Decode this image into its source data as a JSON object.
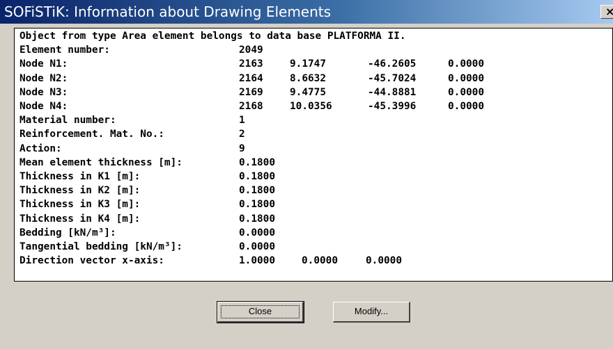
{
  "window": {
    "title": "SOFiSTiK: Information about Drawing Elements",
    "close_glyph": "×"
  },
  "info": {
    "lines": [
      [
        "Object from type Area element belongs to data base PLATFORMA II."
      ],
      [
        "Element number:",
        "2049"
      ],
      [
        "Node N1:",
        "2163",
        "9.1747",
        "-46.2605",
        "0.0000"
      ],
      [
        "Node N2:",
        "2164",
        "8.6632",
        "-45.7024",
        "0.0000"
      ],
      [
        "Node N3:",
        "2169",
        "9.4775",
        "-44.8881",
        "0.0000"
      ],
      [
        "Node N4:",
        "2168",
        "10.0356",
        "-45.3996",
        "0.0000"
      ],
      [
        "Material number:",
        "1"
      ],
      [
        "Reinforcement. Mat. No.:",
        "2"
      ],
      [
        "Action:",
        "9"
      ],
      [
        "Mean element thickness [m]:",
        "0.1800"
      ],
      [
        "Thickness in K1 [m]:",
        "0.1800"
      ],
      [
        "Thickness in K2 [m]:",
        "0.1800"
      ],
      [
        "Thickness in K3 [m]:",
        "0.1800"
      ],
      [
        "Thickness in K4 [m]:",
        "0.1800"
      ],
      [
        "Bedding [kN/m³]:",
        "0.0000"
      ],
      [
        "Tangential bedding [kN/m³]:",
        "0.0000"
      ],
      [
        "Direction vector x-axis:",
        "1.0000",
        "0.0000",
        "0.0000"
      ]
    ]
  },
  "buttons": {
    "close_label": "Close",
    "modify_label": "Modify..."
  }
}
